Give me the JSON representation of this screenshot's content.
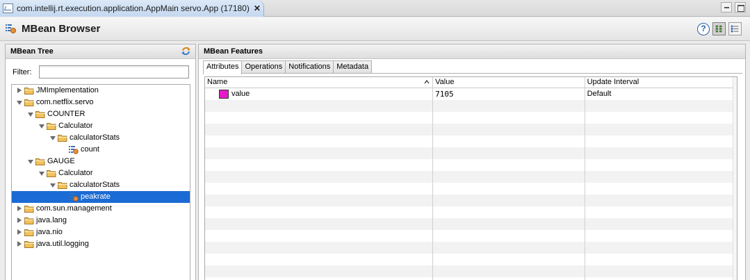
{
  "editor_tab": {
    "title": "com.intellij.rt.execution.application.AppMain servo.App (17180)",
    "close_glyph": "✕"
  },
  "header": {
    "title": "MBean Browser",
    "help_glyph": "?"
  },
  "tree_panel": {
    "title": "MBean Tree",
    "filter_label": "Filter:",
    "filter_value": "",
    "nodes": [
      {
        "label": "JMImplementation",
        "depth": 0,
        "kind": "folder",
        "expanded": false
      },
      {
        "label": "com.netflix.servo",
        "depth": 0,
        "kind": "folder",
        "expanded": true
      },
      {
        "label": "COUNTER",
        "depth": 1,
        "kind": "folder",
        "expanded": true
      },
      {
        "label": "Calculator",
        "depth": 2,
        "kind": "folder",
        "expanded": true
      },
      {
        "label": "calculatorStats",
        "depth": 3,
        "kind": "folder",
        "expanded": true
      },
      {
        "label": "count",
        "depth": 4,
        "kind": "bean",
        "expanded": null
      },
      {
        "label": "GAUGE",
        "depth": 1,
        "kind": "folder",
        "expanded": true
      },
      {
        "label": "Calculator",
        "depth": 2,
        "kind": "folder",
        "expanded": true
      },
      {
        "label": "calculatorStats",
        "depth": 3,
        "kind": "folder",
        "expanded": true
      },
      {
        "label": "peakrate",
        "depth": 4,
        "kind": "bean",
        "expanded": null,
        "selected": true
      },
      {
        "label": "com.sun.management",
        "depth": 0,
        "kind": "folder",
        "expanded": false
      },
      {
        "label": "java.lang",
        "depth": 0,
        "kind": "folder",
        "expanded": false
      },
      {
        "label": "java.nio",
        "depth": 0,
        "kind": "folder",
        "expanded": false
      },
      {
        "label": "java.util.logging",
        "depth": 0,
        "kind": "folder",
        "expanded": false
      }
    ]
  },
  "features_panel": {
    "title": "MBean Features",
    "tabs": [
      {
        "label": "Attributes",
        "active": true
      },
      {
        "label": "Operations",
        "active": false
      },
      {
        "label": "Notifications",
        "active": false
      },
      {
        "label": "Metadata",
        "active": false
      }
    ],
    "columns": [
      "Name",
      "Value",
      "Update Interval"
    ],
    "rows": [
      {
        "name": "value",
        "value": "7105",
        "interval": "Default",
        "color": "#e619c8"
      }
    ],
    "empty_row_count": 16
  },
  "colors": {
    "selection": "#1b6bd4",
    "folder": "#f2c25a",
    "swatch": "#e619c8"
  }
}
